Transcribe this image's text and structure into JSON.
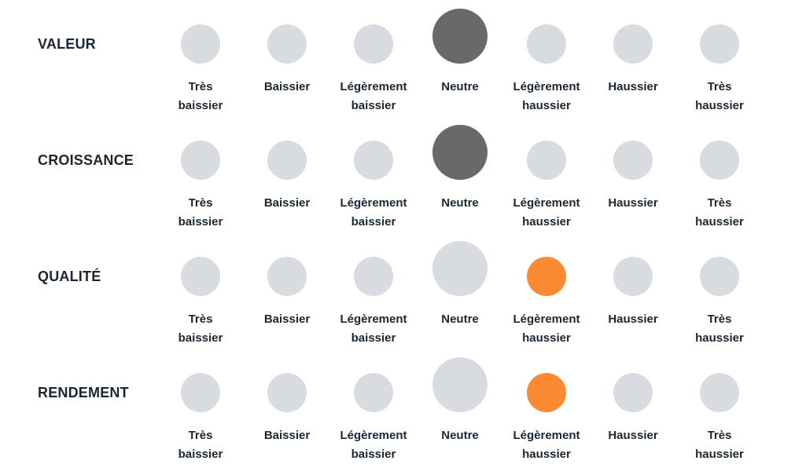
{
  "scale_labels": [
    "Très baissier",
    "Baissier",
    "Légèrement baissier",
    "Neutre",
    "Légèrement haussier",
    "Haussier",
    "Très haussier"
  ],
  "scale_captions": [
    [
      "Très",
      "baissier"
    ],
    [
      "Baissier",
      ""
    ],
    [
      "Légèrement",
      "baissier"
    ],
    [
      "Neutre",
      ""
    ],
    [
      "Légèrement",
      "haussier"
    ],
    [
      "Haussier",
      ""
    ],
    [
      "Très",
      "haussier"
    ]
  ],
  "colors": {
    "inactive": "#d8dbdf",
    "neutral_selected": "#696969",
    "selected": "#fb8a33",
    "text": "#1a2733"
  },
  "rows": [
    {
      "label": "VALEUR",
      "selected_index": 3
    },
    {
      "label": "CROISSANCE",
      "selected_index": 3
    },
    {
      "label": "QUALITÉ",
      "selected_index": 4
    },
    {
      "label": "RENDEMENT",
      "selected_index": 4
    }
  ]
}
